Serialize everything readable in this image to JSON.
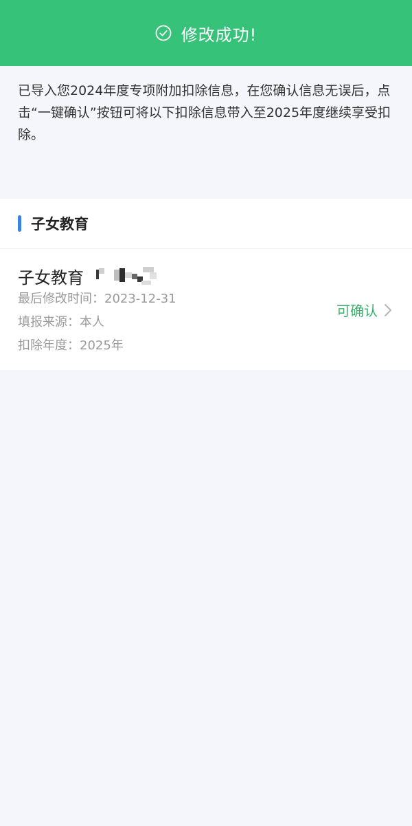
{
  "banner": {
    "title": "修改成功!",
    "icon": "check-circle-icon"
  },
  "notice": {
    "text": "已导入您2024年度专项附加扣除信息，在您确认信息无误后，点击“一键确认”按钮可将以下扣除信息带入至2025年度继续享受扣除。"
  },
  "section": {
    "title": "子女教育"
  },
  "item": {
    "title": "子女教育",
    "modified_time": "最后修改时间：2023-12-31",
    "source": "填报来源：本人",
    "year": "扣除年度：2025年",
    "status": "可确认",
    "status_icon": "chevron-right-icon"
  },
  "colors": {
    "banner": "#37c27a",
    "status": "#37b26c",
    "accent_bar": "#3b82e0",
    "background": "#f4f6fb"
  }
}
